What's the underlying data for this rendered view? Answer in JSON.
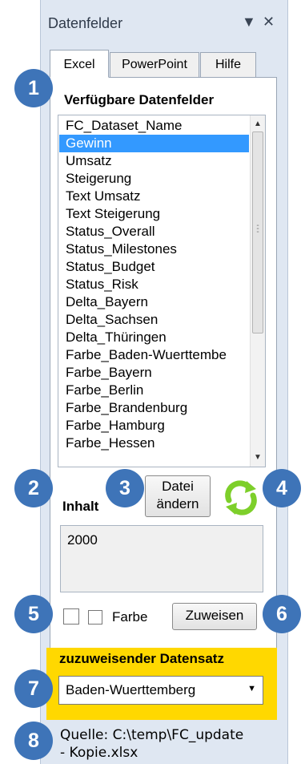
{
  "pane": {
    "title": "Datenfelder",
    "dropdown_icon": "triangle-down-icon",
    "close_icon": "close-icon"
  },
  "tabs": [
    {
      "label": "Excel"
    },
    {
      "label": "PowerPoint"
    },
    {
      "label": "Hilfe"
    }
  ],
  "available_fields": {
    "heading": "Verfügbare Datenfelder",
    "items": [
      "FC_Dataset_Name",
      "Gewinn",
      "Umsatz",
      "Steigerung",
      "Text Umsatz",
      "Text Steigerung",
      "Status_Overall",
      "Status_Milestones",
      "Status_Budget",
      "Status_Risk",
      "Delta_Bayern",
      "Delta_Sachsen",
      "Delta_Thüringen",
      "Farbe_Baden-Wuerttembe",
      "Farbe_Bayern",
      "Farbe_Berlin",
      "Farbe_Brandenburg",
      "Farbe_Hamburg",
      "Farbe_Hessen"
    ],
    "selected": "Gewinn"
  },
  "file_button": {
    "line1": "Datei",
    "line2": "ändern"
  },
  "refresh_icon": "refresh-icon",
  "content": {
    "label": "Inhalt",
    "value": "2000"
  },
  "color_label": "Farbe",
  "assign_button": "Zuweisen",
  "dataset": {
    "heading": "zuzuweisender Datensatz",
    "selected": "Baden-Wuerttemberg"
  },
  "source": {
    "line1": "Quelle: C:\\temp\\FC_update",
    "line2": "- Kopie.xlsx"
  },
  "markers": [
    "1",
    "2",
    "3",
    "4",
    "5",
    "6",
    "7",
    "8"
  ],
  "colors": {
    "marker": "#3e74b8",
    "selection": "#3399ff",
    "highlight": "#ffd800",
    "refresh": "#7dcf2a"
  }
}
